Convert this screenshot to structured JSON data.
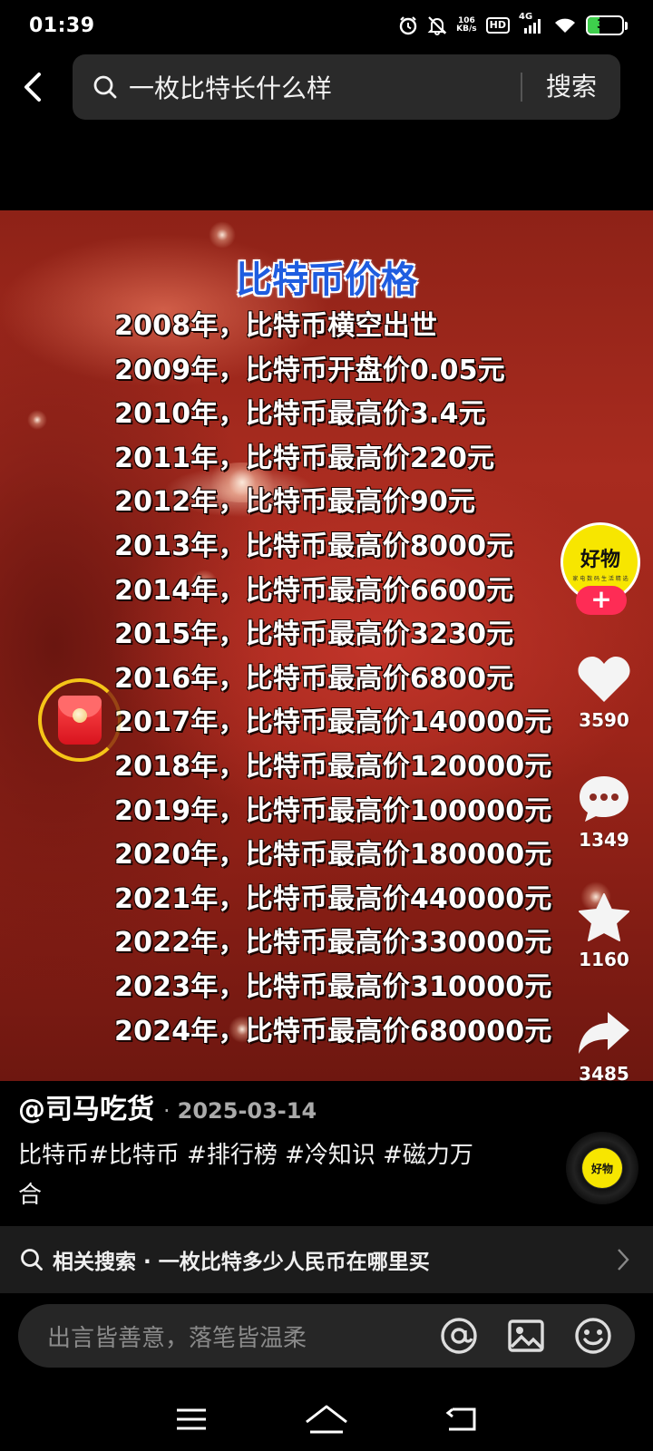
{
  "status_bar": {
    "time": "01:39",
    "net_speed_value": "106",
    "net_speed_unit": "KB/s",
    "hd_label": "HD",
    "network_label": "4G",
    "battery_level": "34"
  },
  "search": {
    "query": "一枚比特长什么样",
    "button_label": "搜索"
  },
  "video": {
    "title": "比特币价格",
    "lines": [
      "2008年，比特币横空出世",
      "2009年，比特币开盘价0.05元",
      "2010年，比特币最高价3.4元",
      "2011年，比特币最高价220元",
      "2012年，比特币最高价90元",
      "2013年，比特币最高价8000元",
      "2014年，比特币最高价6600元",
      "2015年，比特币最高价3230元",
      "2016年，比特币最高价6800元",
      "2017年，比特币最高价140000元",
      "2018年，比特币最高价120000元",
      "2019年，比特币最高价100000元",
      "2020年，比特币最高价180000元",
      "2021年，比特币最高价440000元",
      "2022年，比特币最高价330000元",
      "2023年，比特币最高价310000元",
      "2024年，比特币最高价680000元"
    ]
  },
  "rail": {
    "avatar_text": "好物",
    "avatar_subtext": "家 电 数 码 生 活 精 选",
    "follow_symbol": "+",
    "likes": "3590",
    "comments": "1349",
    "favorites": "1160",
    "shares": "3485"
  },
  "post": {
    "author": "@司马吃货",
    "separator": "·",
    "date": "2025-03-14",
    "description": "比特币#比特币 #排行榜 #冷知识 #磁力万合"
  },
  "music": {
    "disc_text": "好物"
  },
  "related": {
    "text": "相关搜索 · 一枚比特多少人民币在哪里买"
  },
  "comment": {
    "placeholder": "出言皆善意，落笔皆温柔"
  },
  "colors": {
    "accent_red": "#fe2c55",
    "title_blue": "#1f5de0",
    "brand_yellow": "#f7e600",
    "battery_green": "#3ecf4c"
  },
  "icons": [
    "alarm-icon",
    "mute-bell-icon",
    "signal-icon",
    "wifi-icon",
    "battery-icon",
    "back-icon",
    "search-icon",
    "heart-icon",
    "comment-icon",
    "star-icon",
    "share-icon",
    "chevron-right-icon",
    "at-icon",
    "image-icon",
    "emoji-icon",
    "menu-icon",
    "home-icon",
    "return-icon"
  ]
}
